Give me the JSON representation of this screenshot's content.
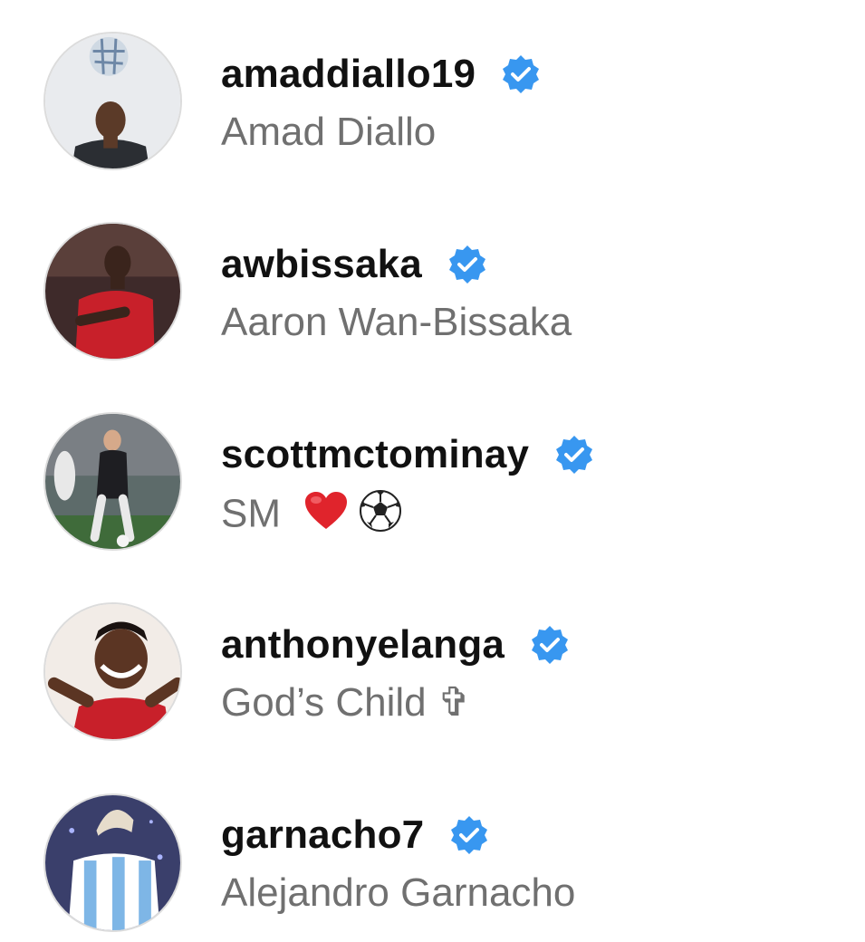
{
  "accounts": [
    {
      "username": "amaddiallo19",
      "full_name": "Amad Diallo",
      "verified": true,
      "avatar": "avatar-amaddiallo19"
    },
    {
      "username": "awbissaka",
      "full_name": "Aaron Wan-Bissaka",
      "verified": true,
      "avatar": "avatar-awbissaka"
    },
    {
      "username": "scottmctominay",
      "full_name": "SM",
      "full_name_emojis": [
        "red-heart-icon",
        "soccer-ball-icon"
      ],
      "verified": true,
      "avatar": "avatar-scottmctominay"
    },
    {
      "username": "anthonyelanga",
      "full_name": "God’s Child ✞",
      "verified": true,
      "avatar": "avatar-anthonyelanga"
    },
    {
      "username": "garnacho7",
      "full_name": "Alejandro Garnacho",
      "verified": true,
      "avatar": "avatar-garnacho7"
    }
  ],
  "colors": {
    "username": "#111111",
    "full_name": "#707070",
    "verified_badge": "#3897f0",
    "background": "#ffffff"
  },
  "icons": {
    "verified": "verified-badge-icon"
  }
}
